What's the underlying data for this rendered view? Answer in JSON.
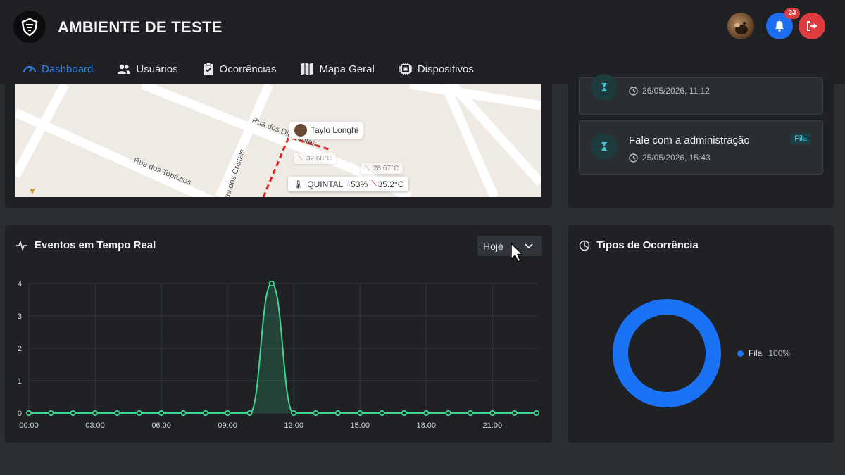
{
  "header": {
    "app_title": "AMBIENTE DE TESTE",
    "notification_count": "23"
  },
  "nav": {
    "items": [
      {
        "label": "Dashboard",
        "icon": "gauge-icon",
        "active": true
      },
      {
        "label": "Usuários",
        "icon": "users-icon",
        "active": false
      },
      {
        "label": "Ocorrências",
        "icon": "clipboard-icon",
        "active": false
      },
      {
        "label": "Mapa Geral",
        "icon": "map-icon",
        "active": false
      },
      {
        "label": "Dispositivos",
        "icon": "chip-icon",
        "active": false
      }
    ]
  },
  "map": {
    "streets": [
      "Rua dos Diamantes",
      "Rua dos Topázios",
      "Rua dos Cristais"
    ],
    "person_label": "Taylo Longhi",
    "sensor_label": "QUINTAL",
    "sensor_humidity": "53%",
    "sensor_temp": "35.2°C",
    "faded_temp_1": "32.68°C",
    "faded_temp_2": "28.67°C"
  },
  "occurrences": {
    "items": [
      {
        "title": "",
        "time": "26/05/2026, 11:12",
        "tag": ""
      },
      {
        "title": "Fale com a administração",
        "time": "25/05/2026, 15:43",
        "tag": "Fila"
      }
    ]
  },
  "events": {
    "title": "Eventos em Tempo Real",
    "period_selected": "Hoje"
  },
  "types": {
    "title": "Tipos de Ocorrência",
    "legend_label": "Fila",
    "legend_value": "100%"
  },
  "colors": {
    "accent": "#2f80ed",
    "line": "#3fd68f",
    "donut": "#1a73f5",
    "danger": "#e03a3e"
  },
  "chart_data": [
    {
      "type": "area",
      "title": "Eventos em Tempo Real",
      "x": [
        "00:00",
        "01:00",
        "02:00",
        "03:00",
        "04:00",
        "05:00",
        "06:00",
        "07:00",
        "08:00",
        "09:00",
        "10:00",
        "11:00",
        "12:00",
        "13:00",
        "14:00",
        "15:00",
        "16:00",
        "17:00",
        "18:00",
        "19:00",
        "20:00",
        "21:00",
        "22:00",
        "23:00"
      ],
      "series": [
        {
          "values": [
            0,
            0,
            0,
            0,
            0,
            0,
            0,
            0,
            0,
            0,
            0,
            4,
            0,
            0,
            0,
            0,
            0,
            0,
            0,
            0,
            0,
            0,
            0,
            0
          ]
        }
      ],
      "x_tick_labels": [
        "00:00",
        "03:00",
        "06:00",
        "09:00",
        "12:00",
        "15:00",
        "18:00",
        "21:00"
      ],
      "y_ticks": [
        0,
        1,
        2,
        3,
        4
      ],
      "ylim": [
        0,
        4
      ],
      "grid": true
    },
    {
      "type": "pie",
      "title": "Tipos de Ocorrência",
      "categories": [
        "Fila"
      ],
      "values": [
        100
      ],
      "legend": "right"
    }
  ]
}
